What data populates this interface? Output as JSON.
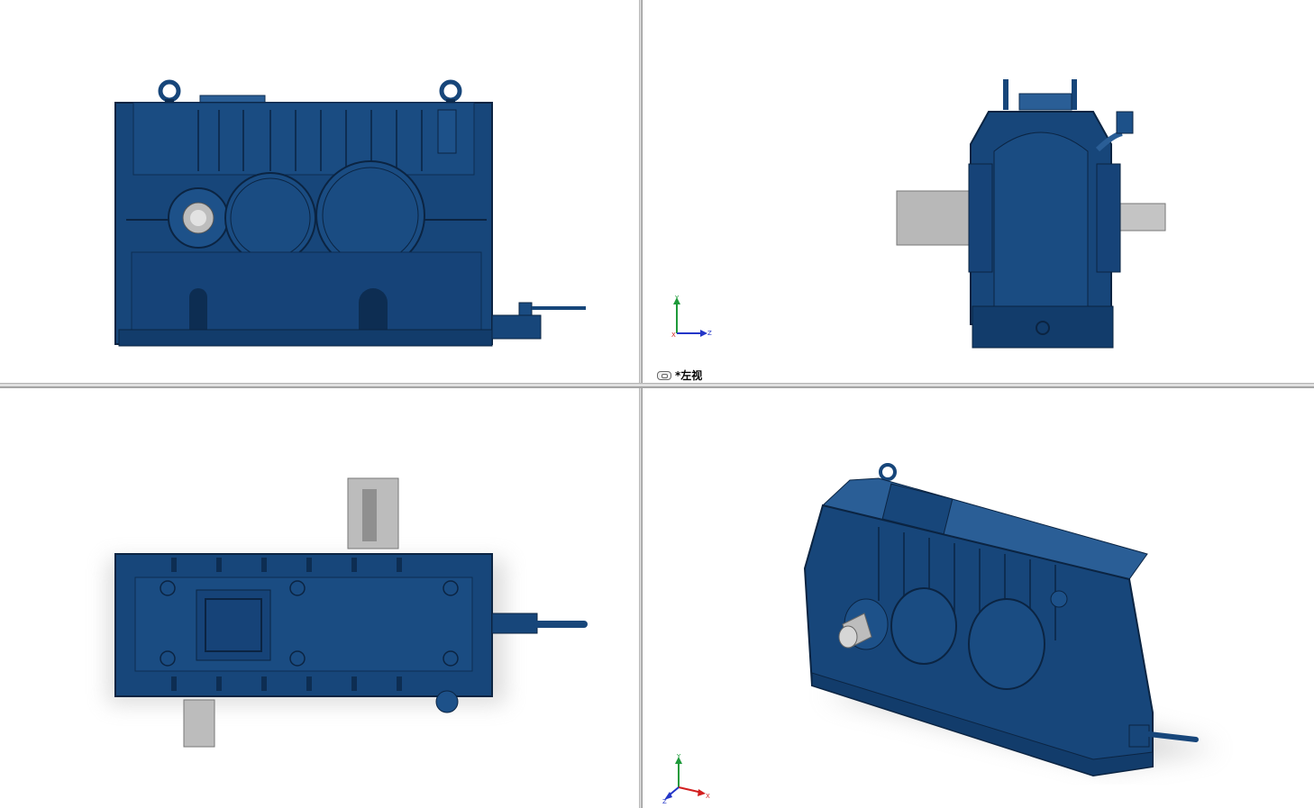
{
  "views": {
    "top_left": {
      "kind": "front"
    },
    "top_right": {
      "kind": "left",
      "label": "*左视"
    },
    "bottom_left": {
      "kind": "top"
    },
    "bottom_right": {
      "kind": "isometric"
    }
  },
  "triad": {
    "x_label": "X",
    "y_label": "Y",
    "z_label": "Z",
    "x_color": "#d21f1f",
    "y_color": "#1e9a3a",
    "z_color": "#2436c8"
  },
  "colors": {
    "housing": "#17467a",
    "housing_dark": "#0d2d52",
    "housing_light": "#2a5e96",
    "shaft": "#b8b8b8",
    "shaft_dark": "#8a8a8a",
    "background": "#ffffff"
  },
  "icons": {
    "view_link": "link-icon"
  }
}
